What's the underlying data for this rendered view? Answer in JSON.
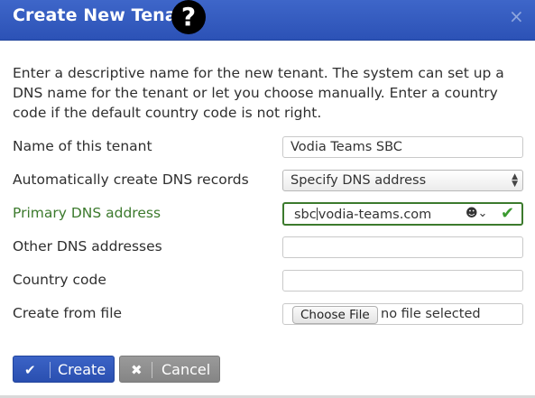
{
  "dialog": {
    "title": "Create New Tenant",
    "help_icon": "?",
    "close_icon": "×",
    "intro": "Enter a descriptive name for the new tenant. The system can set up a DNS name for the tenant or let you choose manually. Enter a country code if the default country code is not right."
  },
  "form": {
    "name": {
      "label": "Name of this tenant",
      "value": "Vodia Teams SBC"
    },
    "auto_dns": {
      "label": "Automatically create DNS records",
      "selected": "Specify DNS address"
    },
    "primary_dns": {
      "label": "Primary DNS address",
      "value_before_caret": "sbc",
      "value_after_caret": "vodia-teams.com"
    },
    "other_dns": {
      "label": "Other DNS addresses",
      "value": ""
    },
    "country": {
      "label": "Country code",
      "value": ""
    },
    "from_file": {
      "label": "Create from file",
      "button": "Choose File",
      "status": "no file selected"
    }
  },
  "buttons": {
    "create": "Create",
    "cancel": "Cancel"
  },
  "colors": {
    "title_bar": "#2c52b6",
    "primary_button": "#2a4fb0",
    "cancel_button": "#8a8a8a",
    "focus_green": "#3c7a2d"
  }
}
